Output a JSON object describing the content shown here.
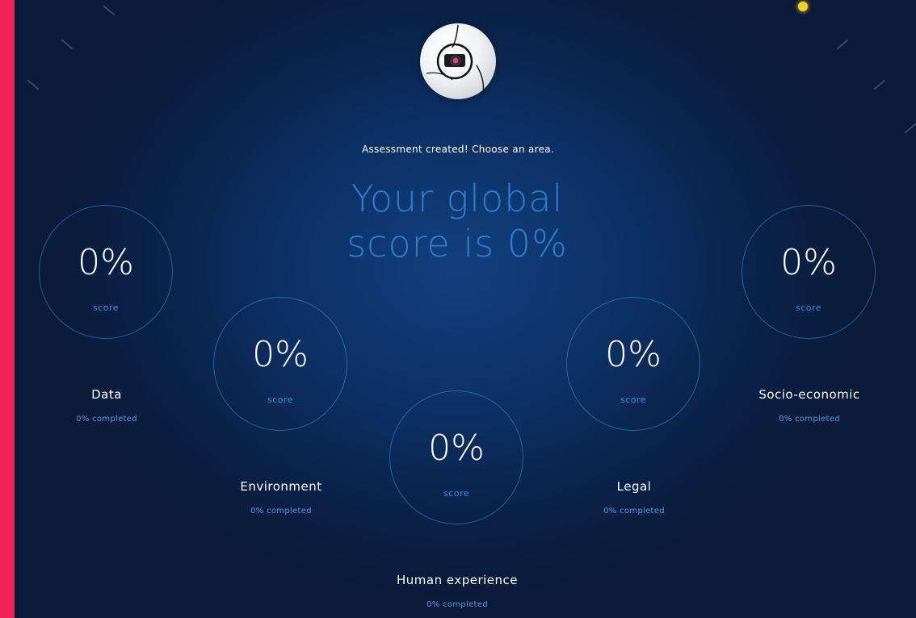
{
  "header": {
    "subtitle": "Assessment created! Choose an area.",
    "global_score": "Your global score is 0%"
  },
  "areas": [
    {
      "name": "Data",
      "percent": "0%",
      "score_label": "score",
      "progress": "0% completed"
    },
    {
      "name": "Environment",
      "percent": "0%",
      "score_label": "score",
      "progress": "0% completed"
    },
    {
      "name": "Human experience",
      "percent": "0%",
      "score_label": "score",
      "progress": "0% completed"
    },
    {
      "name": "Legal",
      "percent": "0%",
      "score_label": "score",
      "progress": "0% completed"
    },
    {
      "name": "Socio-economic",
      "percent": "0%",
      "score_label": "score",
      "progress": "0% completed"
    }
  ],
  "colors": {
    "frame": "#ee2356",
    "background": "#0c2f63",
    "accent_blue": "#2a7fd0",
    "circle_border": "#3c96dc",
    "indicator": "#f4d322"
  },
  "icons": {
    "mascot": "robot-head-icon"
  }
}
